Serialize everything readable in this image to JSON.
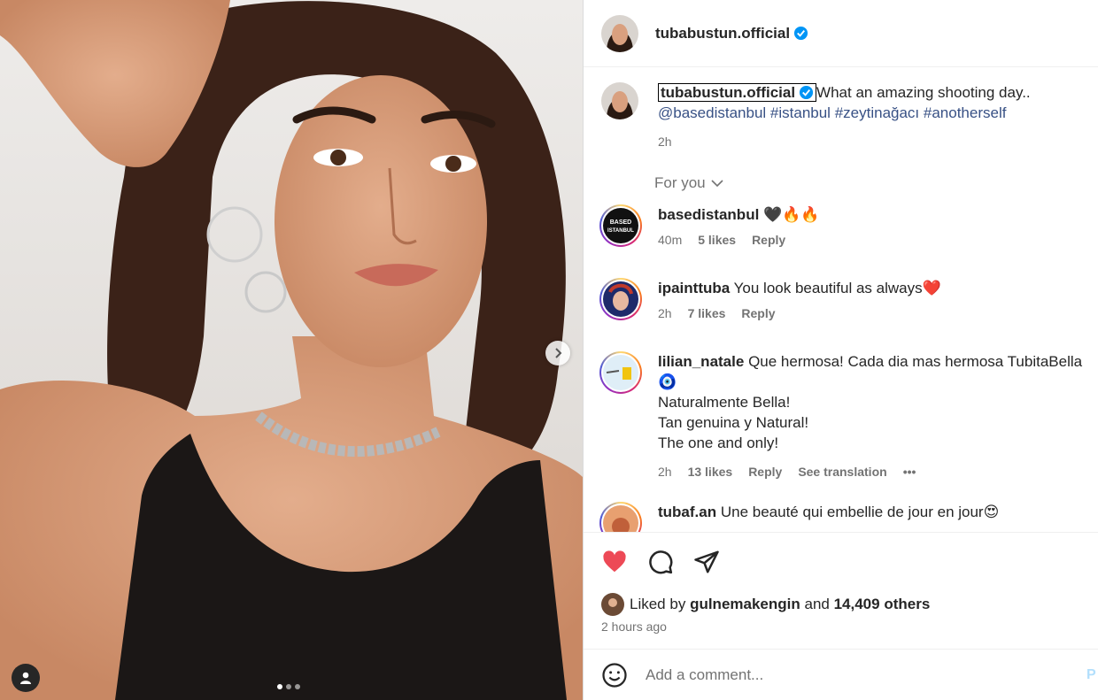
{
  "colors": {
    "accent": "#0095f6",
    "like_red": "#ed4956",
    "hashtag": "#385185",
    "muted": "#737373"
  },
  "post": {
    "username": "tubabustun.official",
    "verified": true,
    "caption_text": "What an amazing shooting day..",
    "hashtags": [
      "@basedistanbul",
      "#istanbul",
      "#zeytinağacı",
      "#anotherself"
    ],
    "caption_time": "2h",
    "carousel_total": 3,
    "carousel_index": 1
  },
  "filter": {
    "label": "For you"
  },
  "comments": [
    {
      "user": "basedistanbul",
      "text": "🖤🔥🔥",
      "time": "40m",
      "likes": "5 likes",
      "reply": "Reply"
    },
    {
      "user": "ipainttuba",
      "text": "You look beautiful as always❤️",
      "time": "2h",
      "likes": "7 likes",
      "reply": "Reply"
    },
    {
      "user": "lilian_natale",
      "text": "Que hermosa! Cada dia mas hermosa TubitaBella 🧿",
      "line2": "Naturalmente Bella!",
      "line3": "Tan genuina y Natural!",
      "line4": "The one and only!",
      "time": "2h",
      "likes": "13 likes",
      "reply": "Reply",
      "translate": "See translation",
      "more": "•••"
    },
    {
      "user": "tubaf.an",
      "text": "Une beauté qui embellie de jour en jour😍"
    }
  ],
  "likes": {
    "prefix": "Liked by",
    "user": "gulnemakengin",
    "and": "and",
    "count": "14,409 others",
    "ago": "2 hours ago"
  },
  "add_comment": {
    "placeholder": "Add a comment...",
    "post": "P"
  },
  "icons": [
    "heart-filled-icon",
    "comment-icon",
    "share-icon",
    "emoji-icon",
    "verified-icon",
    "chevron-right-icon",
    "tag-person-icon"
  ]
}
